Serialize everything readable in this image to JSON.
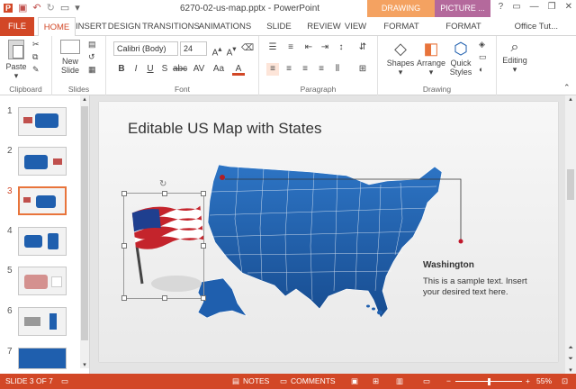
{
  "window": {
    "title": "6270-02-us-map.pptx - PowerPoint",
    "drawing_tools": "DRAWING TOOLS",
    "picture_tools": "PICTURE ...",
    "help": "?",
    "account": "Office Tut..."
  },
  "tabs": [
    "FILE",
    "HOME",
    "INSERT",
    "DESIGN",
    "TRANSITIONS",
    "ANIMATIONS",
    "SLIDE SHOW",
    "REVIEW",
    "VIEW",
    "FORMAT",
    "FORMAT"
  ],
  "ribbon": {
    "clipboard": {
      "paste": "Paste",
      "label": "Clipboard"
    },
    "slides": {
      "new_slide": "New",
      "new_slide2": "Slide",
      "label": "Slides"
    },
    "font": {
      "family": "Calibri (Body)",
      "size": "24",
      "label": "Font"
    },
    "paragraph": {
      "label": "Paragraph"
    },
    "drawing": {
      "shapes": "Shapes",
      "arrange": "Arrange",
      "quick": "Quick",
      "styles": "Styles",
      "label": "Drawing"
    },
    "editing": {
      "label": "Editing"
    }
  },
  "thumbnails": [
    "1",
    "2",
    "3",
    "4",
    "5",
    "6",
    "7"
  ],
  "slide": {
    "title": "Editable US Map with States",
    "state_name": "Washington",
    "body": "This is a sample text. Insert your desired text here."
  },
  "status": {
    "slide_info": "SLIDE 3 OF 7",
    "notes": "NOTES",
    "comments": "COMMENTS",
    "zoom": "55%"
  },
  "colors": {
    "accent": "#d24726",
    "map": "#1f5fae",
    "drawing_tools": "#f4a261",
    "picture_tools": "#b4699c"
  }
}
